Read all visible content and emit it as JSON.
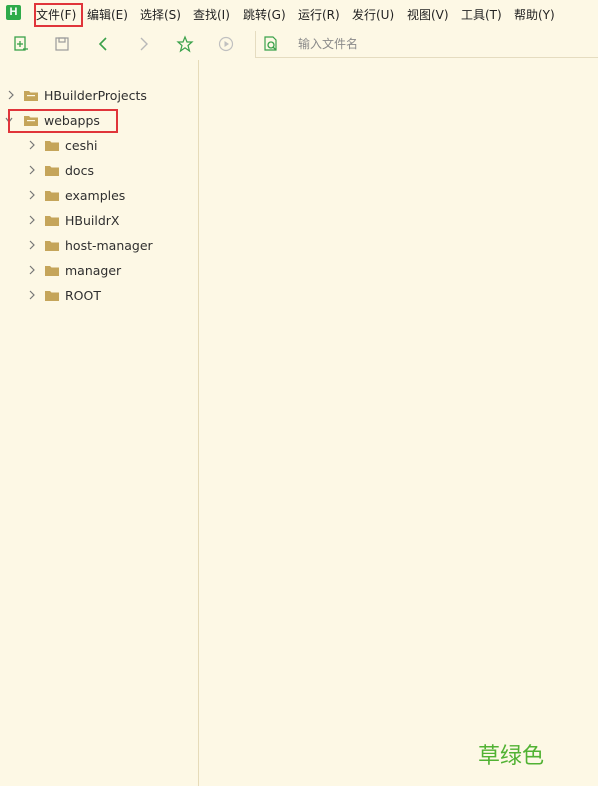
{
  "app": {
    "logo_letter": "H"
  },
  "menu": {
    "items": [
      {
        "label": "文件(F)"
      },
      {
        "label": "编辑(E)"
      },
      {
        "label": "选择(S)"
      },
      {
        "label": "查找(I)"
      },
      {
        "label": "跳转(G)"
      },
      {
        "label": "运行(R)"
      },
      {
        "label": "发行(U)"
      },
      {
        "label": "视图(V)"
      },
      {
        "label": "工具(T)"
      },
      {
        "label": "帮助(Y)"
      }
    ]
  },
  "toolbar": {
    "icons": [
      "new-file-icon",
      "save-icon",
      "back-icon",
      "forward-icon",
      "star-icon",
      "run-icon",
      "file-search-icon"
    ]
  },
  "search": {
    "placeholder": "输入文件名",
    "value": ""
  },
  "tree": {
    "root": {
      "label": "HBuilderProjects",
      "expanded": false
    },
    "webapps": {
      "label": "webapps",
      "expanded": true
    },
    "children": [
      {
        "label": "ceshi"
      },
      {
        "label": "docs"
      },
      {
        "label": "examples"
      },
      {
        "label": "HBuildrX"
      },
      {
        "label": "host-manager"
      },
      {
        "label": "manager"
      },
      {
        "label": "ROOT"
      }
    ]
  },
  "theme": {
    "background": "#fdf8e5",
    "accent": "#2fab4a",
    "highlight": "#e0353a",
    "folder": "#c5a55a"
  },
  "watermark": {
    "text": "草绿色"
  }
}
